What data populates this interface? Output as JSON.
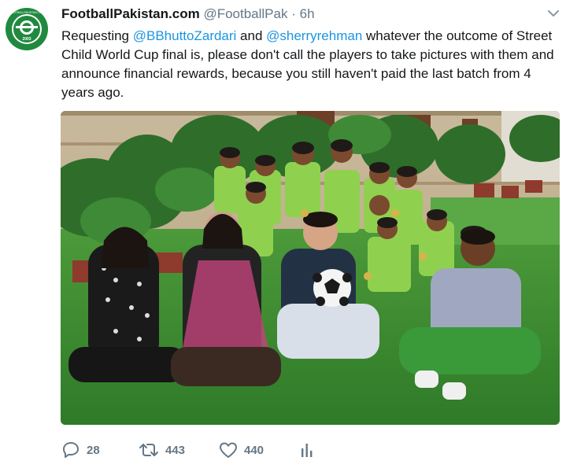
{
  "tweet": {
    "display_name": "FootballPakistan.com",
    "handle": "@FootballPak",
    "separator": "·",
    "time": "6h",
    "text_parts": {
      "p1": "Requesting ",
      "m1": "@BBhuttoZardari",
      "p2": " and ",
      "m2": "@sherryrehman",
      "p3": " whatever the outcome of Street Child World Cup final is, please don't call the players to take pictures with them and announce financial rewards, because you still haven't paid the last batch from 4 years ago."
    },
    "avatar": {
      "ring_text": "FOOTBALLPAKISTAN.COM",
      "year": "2003"
    },
    "actions": {
      "reply_count": "28",
      "retweet_count": "443",
      "like_count": "440"
    }
  },
  "icons": {
    "reply": "reply-icon",
    "retweet": "retweet-icon",
    "like": "heart-icon",
    "analytics": "analytics-icon",
    "menu": "chevron-down-icon"
  },
  "colors": {
    "text": "#14171a",
    "secondary": "#657786",
    "link": "#1b95e0",
    "brand_green": "#1f8a3e"
  }
}
